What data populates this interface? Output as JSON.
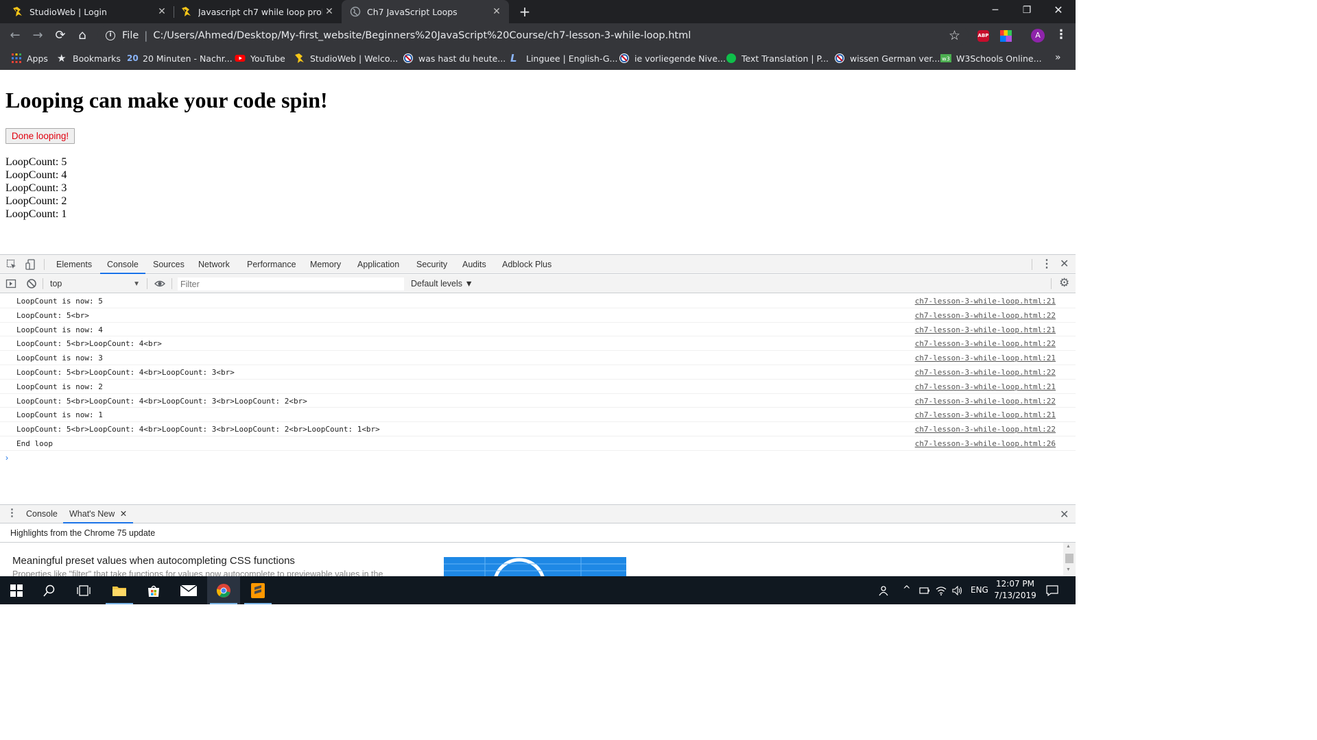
{
  "browser": {
    "tabs": [
      {
        "title": "StudioWeb | Login",
        "icon": "studioweb-icon",
        "active": false
      },
      {
        "title": "Javascript ch7 while loop problem",
        "icon": "studioweb-icon",
        "active": false
      },
      {
        "title": "Ch7 JavaScript Loops",
        "icon": "globe-icon",
        "active": true
      }
    ],
    "new_tab": "+",
    "address": {
      "scheme": "File",
      "url": "C:/Users/Ahmed/Desktop/My-first_website/Beginners%20JavaScript%20Course/ch7-lesson-3-while-loop.html"
    },
    "profile_initial": "A",
    "abp_label": "ABP",
    "bookmarks": [
      {
        "label": "Apps",
        "icon": "apps-grid-icon"
      },
      {
        "label": "Bookmarks",
        "icon": "star-icon"
      },
      {
        "label": "20 Minuten - Nachr...",
        "icon": "20min-icon"
      },
      {
        "label": "YouTube",
        "icon": "youtube-icon"
      },
      {
        "label": "StudioWeb | Welco...",
        "icon": "studioweb-icon"
      },
      {
        "label": "was hast du heute...",
        "icon": "reverso-icon"
      },
      {
        "label": "Linguee | English-G...",
        "icon": "linguee-icon"
      },
      {
        "label": "ie vorliegende Nive...",
        "icon": "reverso-icon"
      },
      {
        "label": "Text Translation | P...",
        "icon": "green-dot-icon"
      },
      {
        "label": "wissen German ver...",
        "icon": "reverso-icon"
      },
      {
        "label": "W3Schools Online...",
        "icon": "w3schools-icon"
      }
    ],
    "bookmarks_more": "»"
  },
  "page": {
    "heading": "Looping can make your code spin!",
    "button_label": "Done looping!",
    "loop_lines": [
      "LoopCount: 5",
      "LoopCount: 4",
      "LoopCount: 3",
      "LoopCount: 2",
      "LoopCount: 1"
    ]
  },
  "devtools": {
    "tabs": [
      "Elements",
      "Console",
      "Sources",
      "Network",
      "Performance",
      "Memory",
      "Application",
      "Security",
      "Audits",
      "Adblock Plus"
    ],
    "active_tab": "Console",
    "context": "top",
    "filter_placeholder": "Filter",
    "levels": "Default levels ▼",
    "messages": [
      {
        "text": "LoopCount is now: 5",
        "source": "ch7-lesson-3-while-loop.html:21"
      },
      {
        "text": "LoopCount: 5<br>",
        "source": "ch7-lesson-3-while-loop.html:22"
      },
      {
        "text": "LoopCount is now: 4",
        "source": "ch7-lesson-3-while-loop.html:21"
      },
      {
        "text": "LoopCount: 5<br>LoopCount: 4<br>",
        "source": "ch7-lesson-3-while-loop.html:22"
      },
      {
        "text": "LoopCount is now: 3",
        "source": "ch7-lesson-3-while-loop.html:21"
      },
      {
        "text": "LoopCount: 5<br>LoopCount: 4<br>LoopCount: 3<br>",
        "source": "ch7-lesson-3-while-loop.html:22"
      },
      {
        "text": "LoopCount is now: 2",
        "source": "ch7-lesson-3-while-loop.html:21"
      },
      {
        "text": "LoopCount: 5<br>LoopCount: 4<br>LoopCount: 3<br>LoopCount: 2<br>",
        "source": "ch7-lesson-3-while-loop.html:22"
      },
      {
        "text": "LoopCount is now: 1",
        "source": "ch7-lesson-3-while-loop.html:21"
      },
      {
        "text": "LoopCount: 5<br>LoopCount: 4<br>LoopCount: 3<br>LoopCount: 2<br>LoopCount: 1<br>",
        "source": "ch7-lesson-3-while-loop.html:22"
      },
      {
        "text": "End loop",
        "source": "ch7-lesson-3-while-loop.html:26"
      }
    ],
    "prompt": "›",
    "drawer": {
      "tabs": [
        "Console",
        "What's New"
      ],
      "active_tab": "What's New",
      "whats_new_heading": "Highlights from the Chrome 75 update",
      "feature_title": "Meaningful preset values when autocompleting CSS functions",
      "feature_desc": "Properties like \"filter\" that take functions for values now autocomplete to previewable values in the"
    }
  },
  "taskbar": {
    "language": "ENG",
    "time": "12:07 PM",
    "date": "7/13/2019"
  },
  "colors": {
    "chrome_dark": "#202124",
    "toolbar": "#35363a",
    "devtools_accent": "#1a73e8",
    "button_text": "#e0000e",
    "taskbar": "#101820"
  }
}
